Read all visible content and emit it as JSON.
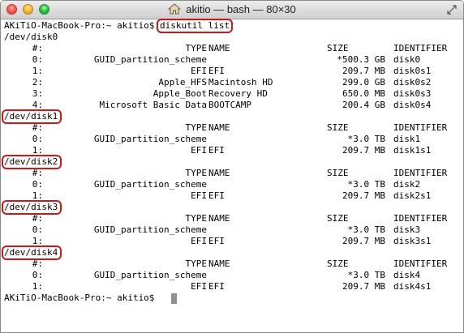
{
  "window": {
    "title": "akitio — bash — 80×30",
    "icons": {
      "close": "close-button",
      "minimize": "minimize-button",
      "maximize": "zoom-button",
      "home": "home-icon",
      "resize": "fullscreen-icon"
    }
  },
  "prompt": {
    "prefix": "AKiTiO-MacBook-Pro:~ akitio$ ",
    "command": "diskutil list",
    "final": "AKiTiO-MacBook-Pro:~ akitio$"
  },
  "headers": {
    "index": "#:",
    "type": "TYPE",
    "name": "NAME",
    "size": "SIZE",
    "identifier": "IDENTIFIER"
  },
  "disks": [
    {
      "device": "/dev/disk0",
      "partitions": [
        {
          "index": "0:",
          "type": "GUID_partition_scheme",
          "name": "",
          "size": "*500.3 GB",
          "identifier": "disk0"
        },
        {
          "index": "1:",
          "type": "EFI",
          "name": "EFI",
          "size": "209.7 MB",
          "identifier": "disk0s1"
        },
        {
          "index": "2:",
          "type": "Apple_HFS",
          "name": "Macintosh HD",
          "size": "299.0 GB",
          "identifier": "disk0s2"
        },
        {
          "index": "3:",
          "type": "Apple_Boot",
          "name": "Recovery HD",
          "size": "650.0 MB",
          "identifier": "disk0s3"
        },
        {
          "index": "4:",
          "type": "Microsoft Basic Data",
          "name": "BOOTCAMP",
          "size": "200.4 GB",
          "identifier": "disk0s4"
        }
      ]
    },
    {
      "device": "/dev/disk1",
      "partitions": [
        {
          "index": "0:",
          "type": "GUID_partition_scheme",
          "name": "",
          "size": "*3.0 TB",
          "identifier": "disk1"
        },
        {
          "index": "1:",
          "type": "EFI",
          "name": "EFI",
          "size": "209.7 MB",
          "identifier": "disk1s1"
        }
      ]
    },
    {
      "device": "/dev/disk2",
      "partitions": [
        {
          "index": "0:",
          "type": "GUID_partition_scheme",
          "name": "",
          "size": "*3.0 TB",
          "identifier": "disk2"
        },
        {
          "index": "1:",
          "type": "EFI",
          "name": "EFI",
          "size": "209.7 MB",
          "identifier": "disk2s1"
        }
      ]
    },
    {
      "device": "/dev/disk3",
      "partitions": [
        {
          "index": "0:",
          "type": "GUID_partition_scheme",
          "name": "",
          "size": "*3.0 TB",
          "identifier": "disk3"
        },
        {
          "index": "1:",
          "type": "EFI",
          "name": "EFI",
          "size": "209.7 MB",
          "identifier": "disk3s1"
        }
      ]
    },
    {
      "device": "/dev/disk4",
      "partitions": [
        {
          "index": "0:",
          "type": "GUID_partition_scheme",
          "name": "",
          "size": "*3.0 TB",
          "identifier": "disk4"
        },
        {
          "index": "1:",
          "type": "EFI",
          "name": "EFI",
          "size": "209.7 MB",
          "identifier": "disk4s1"
        }
      ]
    }
  ],
  "colors": {
    "highlight": "#d01818",
    "text": "#000000",
    "background": "#ffffff"
  }
}
